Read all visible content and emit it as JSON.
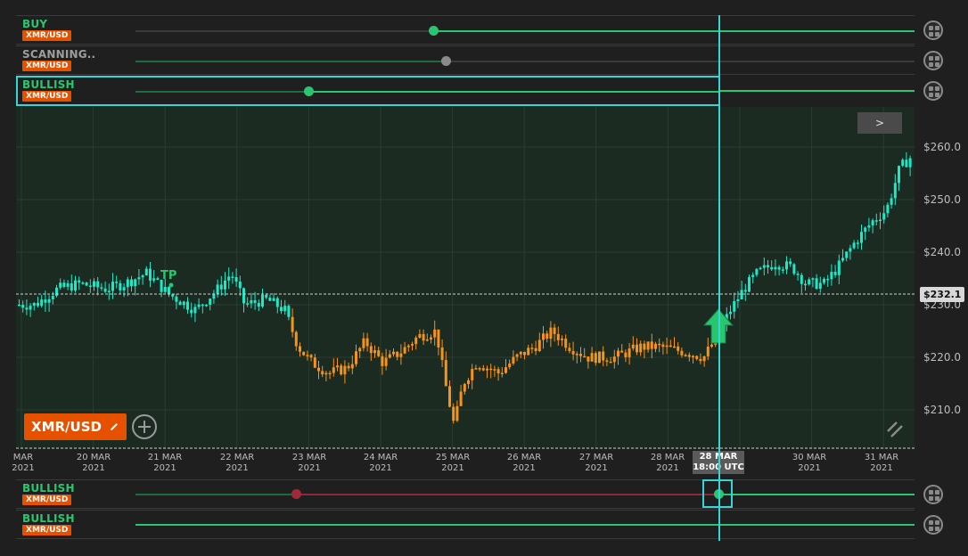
{
  "symbol": "XMR/USD",
  "top_strips": [
    {
      "label": "BUY",
      "symbol": "XMR/USD",
      "label_color": "#28c76f"
    },
    {
      "label": "SCANNING..",
      "symbol": "XMR/USD",
      "label_color": "#9e9e9e"
    },
    {
      "label": "BULLISH",
      "symbol": "XMR/USD",
      "label_color": "#28c76f"
    }
  ],
  "bottom_strips": [
    {
      "label": "BULLISH",
      "symbol": "XMR/USD",
      "label_color": "#28c76f"
    },
    {
      "label": "BULLISH",
      "symbol": "XMR/USD",
      "label_color": "#28c76f"
    }
  ],
  "chart": {
    "badge_label": "XMR/USD",
    "current_price": "$232.1",
    "tp_label": "TP",
    "next_label": ">",
    "price_labels": [
      "$260.0",
      "$250.0",
      "$240.0",
      "$230.0",
      "$220.0",
      "$210.0"
    ],
    "date_labels": [
      {
        "day": "MAR",
        "year": "2021"
      },
      {
        "day": "20 MAR",
        "year": "2021"
      },
      {
        "day": "21 MAR",
        "year": "2021"
      },
      {
        "day": "22 MAR",
        "year": "2021"
      },
      {
        "day": "23 MAR",
        "year": "2021"
      },
      {
        "day": "24 MAR",
        "year": "2021"
      },
      {
        "day": "25 MAR",
        "year": "2021"
      },
      {
        "day": "26 MAR",
        "year": "2021"
      },
      {
        "day": "27 MAR",
        "year": "2021"
      },
      {
        "day": "28 MAR",
        "year": "2021"
      },
      {
        "day": "30 MAR",
        "year": "2021"
      },
      {
        "day": "31 MAR",
        "year": "2021"
      }
    ],
    "cursor_time": {
      "day": "28 MAR",
      "time": "18:00 UTC"
    },
    "colors": {
      "bull": "#1de9c6",
      "bear": "#f7931a",
      "signal": "#28c76f",
      "cursor": "#36d6d6"
    }
  },
  "icons": {
    "side_button": "grid-menu-icon",
    "edit": "pencil-icon",
    "add": "plus-circle-icon",
    "resize": "resize-handle-icon",
    "entry": "arrow-up-icon"
  }
}
